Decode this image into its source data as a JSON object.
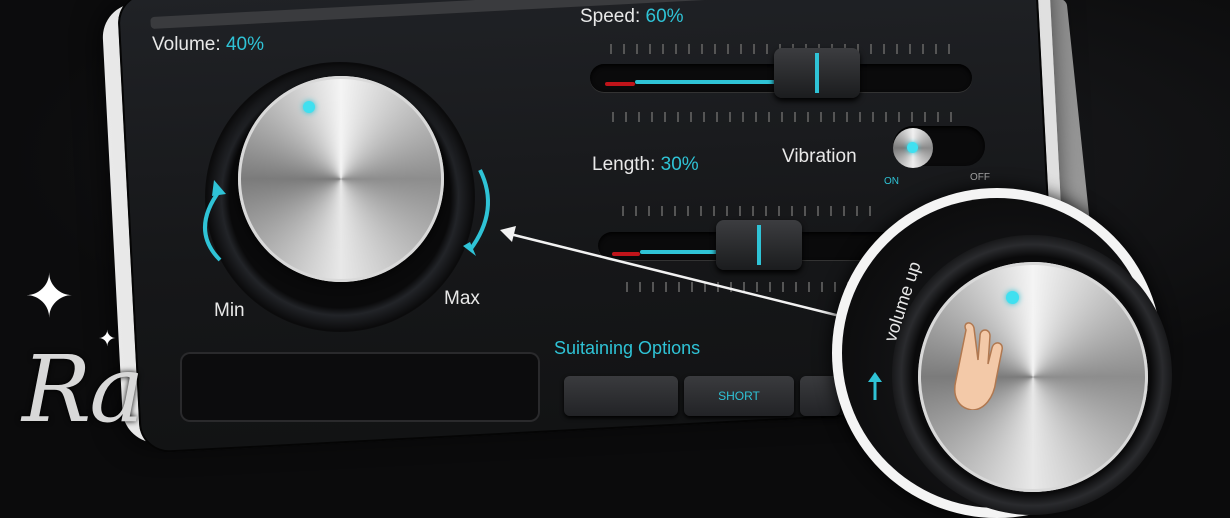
{
  "volume": {
    "label": "Volume: ",
    "value": "40%",
    "min_label": "Min",
    "max_label": "Max"
  },
  "speed": {
    "label": "Speed: ",
    "value": "60%",
    "percent": 60
  },
  "length": {
    "label": "Length: ",
    "value": "30%",
    "percent": 30
  },
  "vibration": {
    "label": "Vibration",
    "on_label": "ON",
    "off_label": "OFF",
    "state": "on"
  },
  "sustaining": {
    "label": "Suitaining Options",
    "buttons": [
      "",
      "SHORT",
      ""
    ]
  },
  "magnifier": {
    "caption": "volume up"
  },
  "brand": {
    "text": "Ra"
  },
  "colors": {
    "accent": "#2fc3d6",
    "fill_red": "#c0141a",
    "panel_bg": "#1c1d20"
  },
  "icons": [
    "knob-dot-icon",
    "sparkle-icon",
    "hand-icon",
    "arrow-icon"
  ]
}
